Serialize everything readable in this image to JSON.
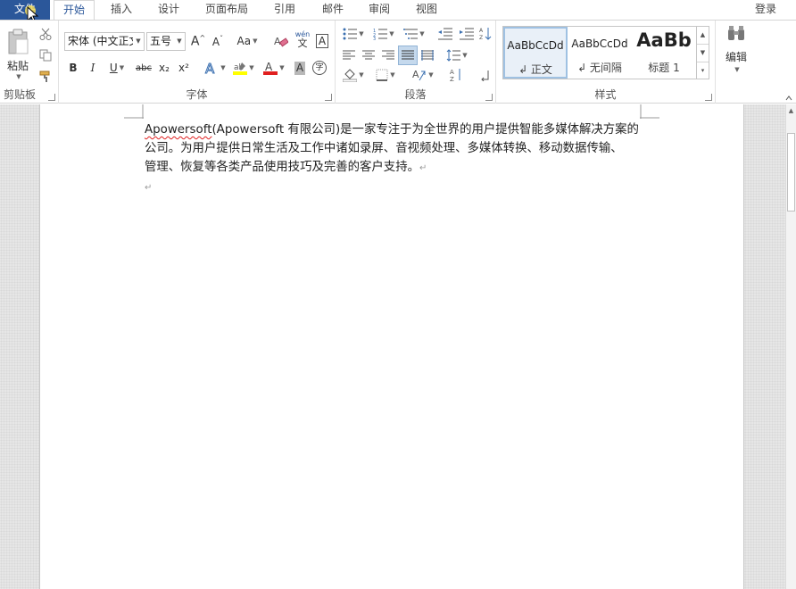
{
  "tabs": {
    "file": "文件",
    "items": [
      "开始",
      "插入",
      "设计",
      "页面布局",
      "引用",
      "邮件",
      "审阅",
      "视图"
    ],
    "active": "开始",
    "login": "登录"
  },
  "clipboard": {
    "paste_label": "粘贴",
    "group_label": "剪贴板"
  },
  "font": {
    "font_name": "宋体 (中文正文",
    "font_size": "五号",
    "change_case": "Aa",
    "pinyin_top": "wén",
    "pinyin_char": "文",
    "border_char": "A",
    "strike": "abc",
    "subscript": "x₂",
    "superscript": "x²",
    "char_shade": "A",
    "enclose": "字",
    "group_label": "字体"
  },
  "paragraph": {
    "group_label": "段落"
  },
  "styles": {
    "items": [
      {
        "sample": "AaBbCcDd",
        "name": "↲ 正文"
      },
      {
        "sample": "AaBbCcDd",
        "name": "↲ 无间隔"
      },
      {
        "sample": "AaBb",
        "name": "标题 1"
      }
    ],
    "group_label": "样式"
  },
  "editing": {
    "label": "编辑"
  },
  "document": {
    "brand": "Apowersoft",
    "line1_rest": "(Apowersoft 有限公司)是一家专注于为全世界的用户提供智能多媒体解决方案的",
    "line2": "公司。为用户提供日常生活及工作中诸如录屏、音视频处理、多媒体转换、移动数据传输、",
    "line3": "管理、恢复等各类产品使用技巧及完善的客户支持。",
    "para_mark": "↵"
  },
  "colors": {
    "file_tab": "#2b579a",
    "highlight": "#ffff00",
    "font_color": "#e02020",
    "selected_style_border": "#9fc1e2"
  }
}
